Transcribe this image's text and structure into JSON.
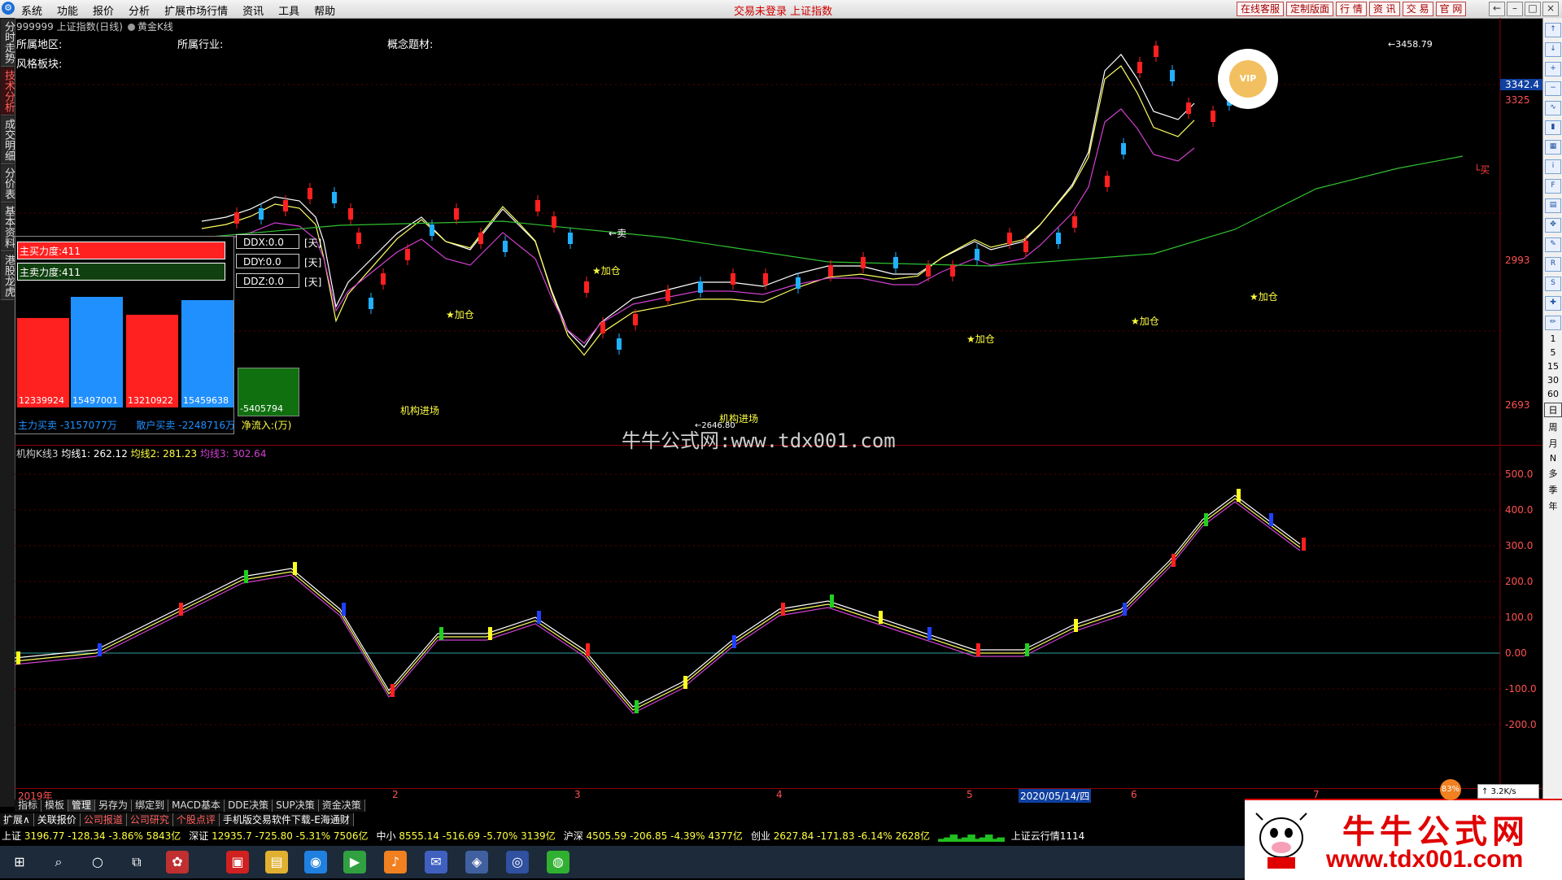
{
  "menu": {
    "items": [
      "系统",
      "功能",
      "报价",
      "分析",
      "扩展市场行情",
      "资讯",
      "工具",
      "帮助"
    ],
    "status": "交易未登录 上证指数",
    "buttons": [
      "在线客服",
      "定制版面",
      "行 情",
      "资 讯",
      "交 易",
      "官 网"
    ]
  },
  "left_tabs": [
    "分时走势",
    "技术分析",
    "成交明细",
    "分价表",
    "基本资料",
    "港股龙虎"
  ],
  "chart": {
    "title": "999999 上证指数(日线)",
    "mode": "黄金K线",
    "region_label": "所属地区:",
    "industry_label": "所属行业:",
    "concept_label": "概念题材:",
    "style_label": "风格板块:",
    "watermark": "牛牛公式网:www.tdx001.com",
    "annotations": {
      "sell": "卖",
      "add1": "★加仓",
      "add2": "★加仓",
      "add3": "★加仓",
      "add4": "★加仓",
      "add5": "★加仓",
      "add6": "★加仓",
      "inst1": "机构进场",
      "inst2": "机构进场",
      "high": "3458.79",
      "low": "2646.80",
      "buy": "买"
    },
    "y_ticks": [
      "3342.4",
      "3325",
      "2993",
      "2693"
    ],
    "x_ticks": [
      "2019年",
      "2",
      "3",
      "4",
      "5",
      "2020/05/14/四",
      "6",
      "7"
    ]
  },
  "force_panel": {
    "main_buy": "主买力度:411",
    "main_sell": "主卖力度:411",
    "volumes": [
      "12339924",
      "15497001",
      "13210922",
      "15459638",
      "-5405794"
    ],
    "main_flow": "主力买卖 -3157077万",
    "retail_flow": "散户买卖 -2248716万",
    "net_flow": "净流入:(万)",
    "ddx": "DDX:0.0",
    "ddy": "DDY:0.0",
    "ddz": "DDZ:0.0",
    "unit": "[天]"
  },
  "indicator": {
    "name": "机构K线3",
    "ma1": "均线1: 262.12",
    "ma2": "均线2: 281.23",
    "ma3": "均线3: 302.64",
    "y_ticks": [
      "500.0",
      "400.0",
      "300.0",
      "200.0",
      "100.0",
      "0.00",
      "-100.0",
      "-200.0"
    ]
  },
  "toolbar1": [
    "指标",
    "模板",
    "管理",
    "另存为",
    "绑定到",
    "MACD基本",
    "DDE决策",
    "SUP决策",
    "资金决策"
  ],
  "toolbar2": [
    "扩展∧",
    "关联报价",
    "公司报道",
    "公司研究",
    "个股点评",
    "手机版交易软件下载-E海通财"
  ],
  "ticker": [
    {
      "name": "上证",
      "value": "3196.77 -128.34 -3.86% 5843亿"
    },
    {
      "name": "深证",
      "value": "12935.7 -725.80 -5.31% 7506亿"
    },
    {
      "name": "中小",
      "value": "8555.14 -516.69 -5.70% 3139亿"
    },
    {
      "name": "沪深",
      "value": "4505.59 -206.85 -4.39% 4377亿"
    },
    {
      "name": "创业",
      "value": "2627.84 -171.83 -6.14% 2628亿"
    },
    {
      "name": "",
      "value": "上证云行情1114"
    }
  ],
  "periods": [
    "1",
    "5",
    "15",
    "30",
    "60",
    "日",
    "周",
    "月",
    "N",
    "多",
    "季",
    "年"
  ],
  "ad": {
    "title": "牛牛公式网",
    "url": "www.tdx001.com"
  },
  "speed": "83%",
  "net": "3.2K/s",
  "colors": {
    "up": "#ff2020",
    "down": "#20b0ff",
    "ma_white": "#ffffff",
    "ma_yellow": "#ffff60",
    "ma_purple": "#d040d0",
    "ma_green": "#30c030"
  }
}
